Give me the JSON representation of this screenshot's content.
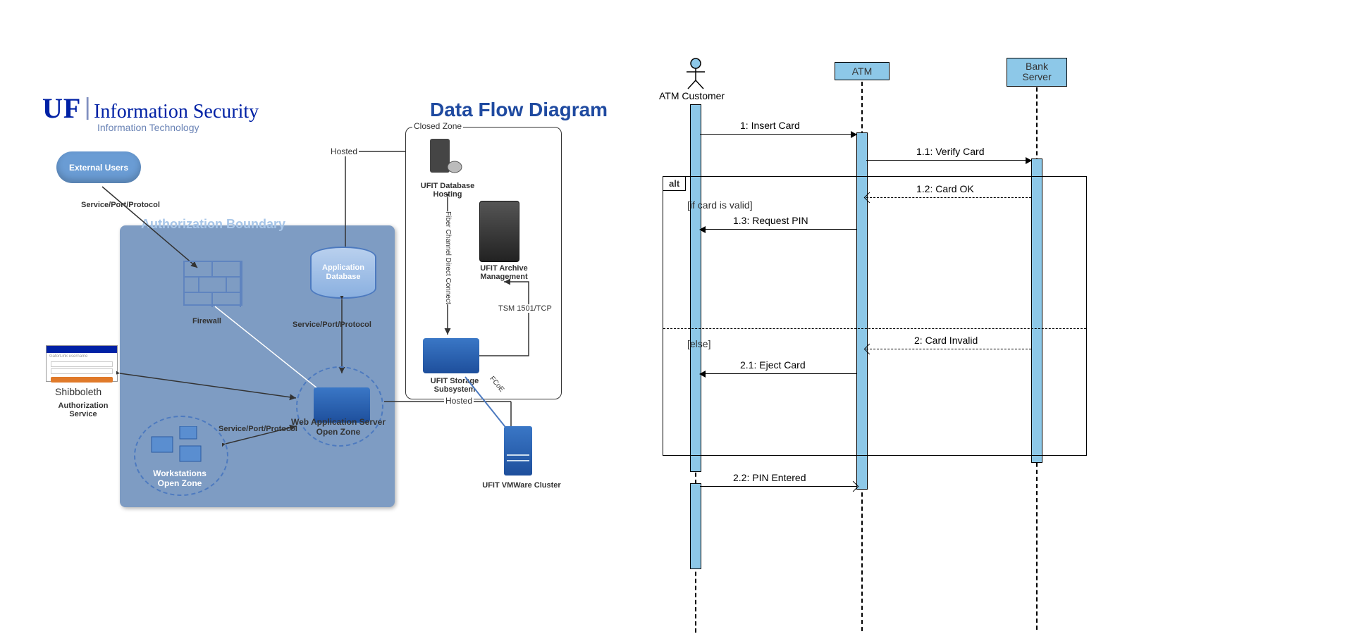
{
  "left": {
    "logo_uf": "UF",
    "logo_title": "Information Security",
    "logo_sub": "Information Technology",
    "title": "Data Flow Diagram",
    "boundary_title": "Authorization Boundary",
    "nodes": {
      "external_users": "External Users",
      "firewall": "Firewall",
      "app_db": "Application Database",
      "web_app_server": "Web Application Server",
      "open_zone": "Open Zone",
      "workstations": "Workstations",
      "shibboleth": "Shibboleth",
      "auth_service": "Authorization Service",
      "ufit_db_hosting": "UFIT Database Hosting",
      "ufit_archive": "UFIT Archive Management",
      "ufit_storage": "UFIT Storage Subsystem",
      "ufit_vmware": "UFIT VMWare Cluster",
      "closed_zone": "Closed Zone"
    },
    "edges": {
      "spp": "Service/Port/Protocol",
      "hosted": "Hosted",
      "fiber": "Fiber Channel Direct Connect",
      "tsm": "TSM 1501/TCP",
      "fcoe": "FCoE"
    }
  },
  "right": {
    "actor": "ATM Customer",
    "obj_atm": "ATM",
    "obj_bank": "Bank Server",
    "alt_tag": "alt",
    "guard_valid": "[if card is valid]",
    "guard_else": "[else]",
    "messages": {
      "m1": "1: Insert Card",
      "m11": "1.1: Verify Card",
      "m12": "1.2: Card OK",
      "m13": "1.3: Request PIN",
      "m2": "2: Card Invalid",
      "m21": "2.1: Eject Card",
      "m22": "2.2: PIN Entered"
    }
  }
}
